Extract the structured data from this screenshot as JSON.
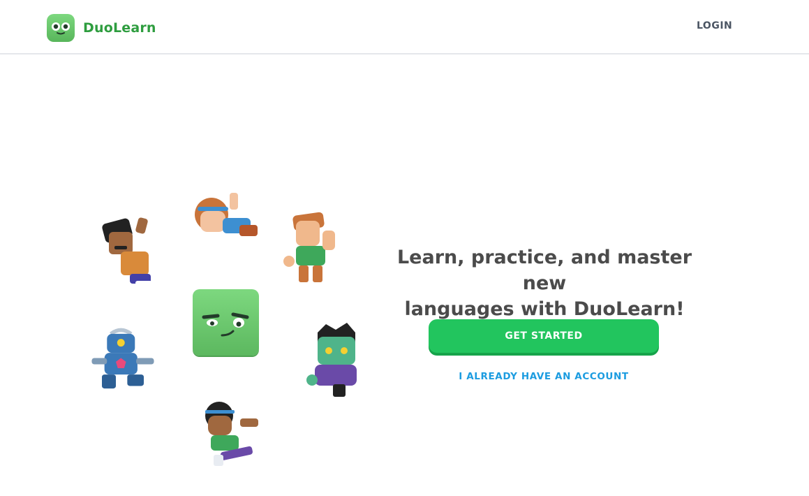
{
  "header": {
    "brand": "DuoLearn",
    "login_label": "LOGIN"
  },
  "hero": {
    "headline_line1": "Learn, practice, and master new",
    "headline_line2": "languages with DuoLearn!",
    "primary_cta": "GET STARTED",
    "secondary_cta": "I ALREADY HAVE AN ACCOUNT"
  },
  "colors": {
    "brand_green": "#2e9d3f",
    "button_green": "#22c55e",
    "link_blue": "#1c9ce0",
    "text": "#4b4b4b"
  },
  "illustration": {
    "characters": [
      "man-with-mustache-character",
      "girl-with-headband-character",
      "boy-with-backpack-character",
      "robot-character",
      "zombie-character",
      "girl-running-character"
    ],
    "center_icon": "green-block-face-icon"
  }
}
